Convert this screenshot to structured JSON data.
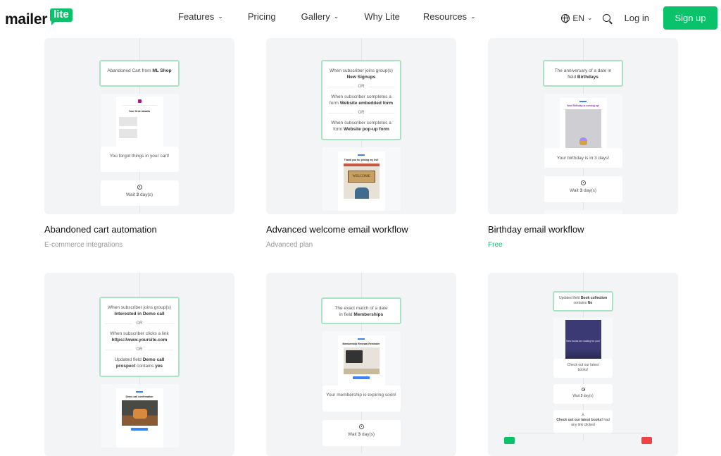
{
  "nav": {
    "logo": {
      "word": "mailer",
      "badge": "lite"
    },
    "menu": [
      {
        "label": "Features",
        "dropdown": true
      },
      {
        "label": "Pricing",
        "dropdown": false
      },
      {
        "label": "Gallery",
        "dropdown": true
      },
      {
        "label": "Why Lite",
        "dropdown": false
      },
      {
        "label": "Resources",
        "dropdown": true
      }
    ],
    "language": "EN",
    "login": "Log in",
    "signup": "Sign up",
    "accent": "#09c269"
  },
  "cards": [
    {
      "title": "Abandoned cart automation",
      "subtitle": "E-commerce integrations",
      "trigger": {
        "pre": "Abandoned Cart from ",
        "bold": "ML Shop"
      },
      "email_preview": {
        "heading": "Your Order Awaits",
        "caption": "You forgot things in your cart!"
      },
      "wait": {
        "pre": "Wait ",
        "bold": "3",
        "post": " day(s)"
      }
    },
    {
      "title": "Advanced welcome email workflow",
      "subtitle": "Advanced plan",
      "triggers": [
        {
          "pre": "When subscriber joins group(s) ",
          "bold": "New Signups"
        },
        {
          "pre": "When subscriber completes a form ",
          "bold": "Website embedded form"
        },
        {
          "pre": "When subscriber completes a form ",
          "bold": "Website pop-up form"
        }
      ],
      "or_label": "OR",
      "email_preview": {
        "heading": "Thank you for joining my list!",
        "image_text": "WELCOME"
      }
    },
    {
      "title": "Birthday email workflow",
      "subtitle": "Free",
      "trigger": {
        "pre": "The anniversary of a date in field ",
        "bold": "Birthdays"
      },
      "email_preview": {
        "heading": "Your Birthday is coming up!",
        "caption": "Your birthday is in 3 days!"
      },
      "wait": {
        "pre": "Wait ",
        "bold": "3",
        "post": " day(s)"
      }
    },
    {
      "triggers": [
        {
          "pre": "When subscriber joins group(s) ",
          "bold": "Interested in Demo call"
        },
        {
          "pre": "When subscriber clicks a link ",
          "bold": "https://www.yoursite.com"
        },
        {
          "pre": "Updated field ",
          "bold": "Demo call prospect",
          "post": " contains ",
          "bold2": "yes"
        }
      ],
      "or_label": "OR",
      "email_preview": {
        "heading": "Demo call confirmation"
      }
    },
    {
      "trigger": {
        "pre": "The exact match of a date in field ",
        "bold": "Memberships"
      },
      "email_preview": {
        "heading": "Membership Renewal Reminder",
        "caption": "Your membership is expiring soon!"
      },
      "wait": {
        "pre": "Wait ",
        "bold": "3",
        "post": " day(s)"
      }
    },
    {
      "trigger": {
        "pre": "Updated field ",
        "bold": "Book collection",
        "post": " contains ",
        "bold2": "No"
      },
      "email_preview": {
        "image_text": "New books are waiting for you!",
        "caption": "Check out our latest books!"
      },
      "wait": {
        "pre": "Wait ",
        "bold": "3",
        "post": " day(s)"
      },
      "condition": {
        "bold": "Check out our latest books!",
        "post": " had any link clicked"
      },
      "branches": [
        {
          "color": "#09c269"
        },
        {
          "color": "#ef4444"
        }
      ]
    }
  ]
}
